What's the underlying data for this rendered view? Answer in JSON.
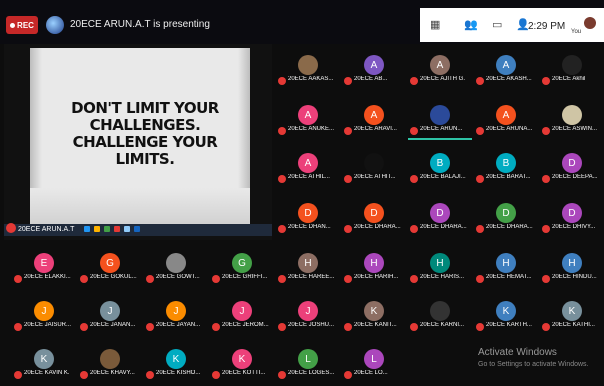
{
  "header": {
    "rec_label": "REC",
    "presenting_text": "20ECE ARUN.A.T is presenting",
    "toolbar_icons": [
      "grid-icon",
      "people-icon",
      "chat-icon",
      "person-icon"
    ],
    "time": "2:29 PM",
    "you_label": "You"
  },
  "slide": {
    "quote": "DON'T LIMIT YOUR CHALLENGES. CHALLENGE YOUR LIMITS.",
    "presenter_label": "20ECE ARUN.A.T"
  },
  "tiles": [
    {
      "name": "20ECE AAKAS...",
      "initial": "",
      "color": "#8a6a4a"
    },
    {
      "name": "20ECE AB...",
      "initial": "A",
      "color": "#7e57c2"
    },
    {
      "name": "20ECE AJITH G.",
      "initial": "A",
      "color": "#8d6e63"
    },
    {
      "name": "20ECE AKASH...",
      "initial": "A",
      "color": "#3f7fbf"
    },
    {
      "name": "20ECE Akhil",
      "initial": "",
      "color": "#222"
    },
    {
      "name": "20ECE ANUKE...",
      "initial": "A",
      "color": "#ec407a"
    },
    {
      "name": "20ECE ARAVI...",
      "initial": "A",
      "color": "#f4511e"
    },
    {
      "name": "20ECE ARUN...",
      "initial": "",
      "color": "#2b4a9a"
    },
    {
      "name": "20ECE ARUNA...",
      "initial": "A",
      "color": "#f4511e"
    },
    {
      "name": "20ECE ASWIN...",
      "initial": "",
      "color": "#cfc5a5"
    },
    {
      "name": "20ECE ATHIL...",
      "initial": "A",
      "color": "#ec407a"
    },
    {
      "name": "20ECE ATHIT...",
      "initial": "",
      "color": "#111"
    },
    {
      "name": "20ECE BALAJI...",
      "initial": "B",
      "color": "#00acc1"
    },
    {
      "name": "20ECE BARAT...",
      "initial": "B",
      "color": "#00acc1"
    },
    {
      "name": "20ECE DEEPA...",
      "initial": "D",
      "color": "#ab47bc"
    },
    {
      "name": "20ECE DHAN...",
      "initial": "D",
      "color": "#f4511e"
    },
    {
      "name": "20ECE DHARA...",
      "initial": "D",
      "color": "#f4511e"
    },
    {
      "name": "20ECE DHARA...",
      "initial": "D",
      "color": "#ab47bc"
    },
    {
      "name": "20ECE DHARA...",
      "initial": "D",
      "color": "#43a047"
    },
    {
      "name": "20ECE DHIVY...",
      "initial": "D",
      "color": "#ab47bc"
    },
    {
      "name": "20ECE ELAKKI...",
      "initial": "E",
      "color": "#ec407a"
    },
    {
      "name": "20ECE GOKUL...",
      "initial": "G",
      "color": "#f4511e"
    },
    {
      "name": "20ECE GOWT...",
      "initial": "",
      "color": "#888"
    },
    {
      "name": "20ECE GRIFFI...",
      "initial": "G",
      "color": "#43a047"
    },
    {
      "name": "20ECE HAREE...",
      "initial": "H",
      "color": "#8d6e63"
    },
    {
      "name": "20ECE HARIH...",
      "initial": "H",
      "color": "#ab47bc"
    },
    {
      "name": "20ECE HARIS...",
      "initial": "H",
      "color": "#00897b"
    },
    {
      "name": "20ECE HEMAT...",
      "initial": "H",
      "color": "#3f7fbf"
    },
    {
      "name": "20ECE HINDU...",
      "initial": "H",
      "color": "#3f7fbf"
    },
    {
      "name": "20ECE JAISUR...",
      "initial": "J",
      "color": "#fb8c00"
    },
    {
      "name": "20ECE JANAN...",
      "initial": "J",
      "color": "#78909c"
    },
    {
      "name": "20ECE JAYAN...",
      "initial": "J",
      "color": "#fb8c00"
    },
    {
      "name": "20ECE JEROM...",
      "initial": "J",
      "color": "#ec407a"
    },
    {
      "name": "20ECE JOSHU...",
      "initial": "J",
      "color": "#ec407a"
    },
    {
      "name": "20ECE KANIT...",
      "initial": "K",
      "color": "#8d6e63"
    },
    {
      "name": "20ECE KARNI...",
      "initial": "",
      "color": "#333"
    },
    {
      "name": "20ECE KARTH...",
      "initial": "K",
      "color": "#3f7fbf"
    },
    {
      "name": "20ECE KATHI...",
      "initial": "K",
      "color": "#78909c"
    },
    {
      "name": "20ECE KAVIN K.",
      "initial": "K",
      "color": "#78909c"
    },
    {
      "name": "20ECE KHAVY...",
      "initial": "",
      "color": "#7a5a3a"
    },
    {
      "name": "20ECE KISHO...",
      "initial": "K",
      "color": "#00acc1"
    },
    {
      "name": "20ECE KOTTI...",
      "initial": "K",
      "color": "#ec407a"
    },
    {
      "name": "20ECE LOGES...",
      "initial": "L",
      "color": "#43a047"
    },
    {
      "name": "20ECE LO...",
      "initial": "L",
      "color": "#ab47bc"
    }
  ],
  "watermark": {
    "line1": "Activate Windows",
    "line2": "Go to Settings to activate Windows."
  }
}
